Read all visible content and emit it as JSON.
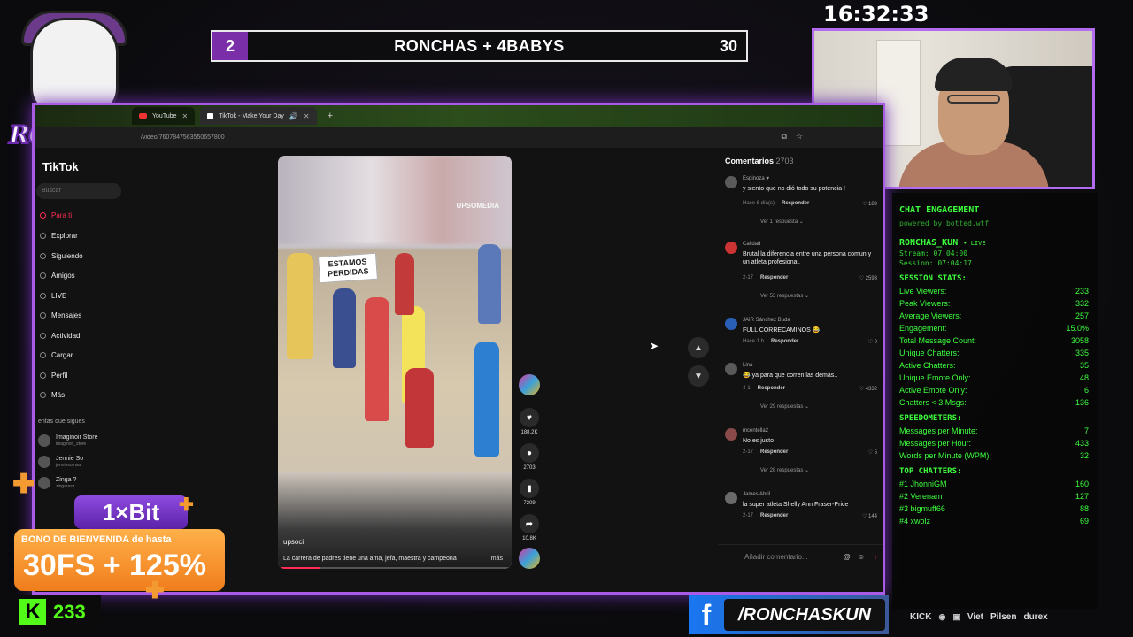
{
  "overlay": {
    "clock": "16:32:33",
    "scorebar": {
      "left_score": "2",
      "title": "RONCHAS + 4BABYS",
      "right_score": "30"
    },
    "logo_text": "RONCHAS"
  },
  "browser": {
    "tabs": [
      {
        "label": "YouTube",
        "icon": "youtube-icon"
      },
      {
        "label": "TikTok - Make Your Day",
        "icon": "tiktok-icon"
      }
    ],
    "url": "/video/7607847563550657800"
  },
  "tiktok": {
    "logo": "TikTok",
    "search_placeholder": "Buscar",
    "nav": [
      "Para ti",
      "Explorar",
      "Siguiendo",
      "Amigos",
      "LIVE",
      "Mensajes",
      "Actividad",
      "Cargar",
      "Perfil",
      "Más"
    ],
    "following_header": "entas que sigues",
    "accounts": [
      {
        "name": "Imaginoir Store",
        "handle": "imaginoir_store"
      },
      {
        "name": "Jennie So",
        "handle": "jenniesomsa"
      },
      {
        "name": "Zinga ?",
        "handle": "zingarasz"
      }
    ],
    "video": {
      "watermark": "UPSOMEDIA",
      "sign_text": "ESTAMOS PERDIDAS",
      "author": "upsoci",
      "caption": "La carrera de padres tiene una ama, jefa, maestra y campeona",
      "more": "más",
      "progress": 0.18
    },
    "actions": [
      {
        "icon": "heart-icon",
        "count": "188.2K"
      },
      {
        "icon": "comment-icon",
        "count": "2703"
      },
      {
        "icon": "bookmark-icon",
        "count": "7209"
      },
      {
        "icon": "share-icon",
        "count": "10.8K"
      }
    ],
    "comments_header": "Comentarios",
    "comments_count": "2703",
    "comments": [
      {
        "user": "Espinoza ♥",
        "text": "y siento que no dió todo su potencia !",
        "time": "Hace 6 día(s)",
        "reply": "Responder",
        "likes": "189",
        "more": "Ver 1 respuesta ⌄"
      },
      {
        "user": "Calidad",
        "text": "Brutal la diferencia entre una persona comun y un atleta profesional.",
        "time": "2-17",
        "reply": "Responder",
        "likes": "2593",
        "more": "Ver 53 respuestas ⌄"
      },
      {
        "user": "JAIR Sánchez Buda",
        "text": "FULL CORRECAMINOS 😂",
        "time": "Hace 1 h",
        "reply": "Responder",
        "likes": "0",
        "more": ""
      },
      {
        "user": "Lina",
        "text": "😂 ya para que corren las demás..",
        "time": "4-1",
        "reply": "Responder",
        "likes": "4332",
        "more": "Ver 29 respuestas ⌄"
      },
      {
        "user": "mcentella2",
        "text": "No es justo",
        "time": "2-17",
        "reply": "Responder",
        "likes": "5",
        "more": "Ver 28 respuestas ⌄"
      },
      {
        "user": "James Abril",
        "text": "la super atleta Shelly Ann Fraser-Price",
        "time": "2-17",
        "reply": "Responder",
        "likes": "144",
        "more": ""
      }
    ],
    "comment_placeholder": "Añadir comentario..."
  },
  "stats": {
    "title": "CHAT ENGAGEMENT",
    "powered": "powered by botted.wtf",
    "username": "RONCHAS_KUN",
    "live_badge": "• LIVE",
    "stream": "Stream: 07:04:00",
    "session": "Session: 07:04:17",
    "sections": [
      {
        "title": "SESSION STATS:",
        "rows": [
          [
            "Live Viewers:",
            "233"
          ],
          [
            "Peak Viewers:",
            "332"
          ],
          [
            "Average Viewers:",
            "257"
          ],
          [
            "Engagement:",
            "15.0%"
          ],
          [
            "Total Message Count:",
            "3058"
          ],
          [
            "Unique Chatters:",
            "335"
          ],
          [
            "Active Chatters:",
            "35"
          ],
          [
            "Unique Emote Only:",
            "48"
          ],
          [
            "Active Emote Only:",
            "6"
          ],
          [
            "Chatters < 3 Msgs:",
            "136"
          ]
        ]
      },
      {
        "title": "SPEEDOMETERS:",
        "rows": [
          [
            "Messages per Minute:",
            "7"
          ],
          [
            "Messages per Hour:",
            "433"
          ],
          [
            "Words per Minute (WPM):",
            "32"
          ]
        ]
      },
      {
        "title": "TOP CHATTERS:",
        "rows": [
          [
            "#1 JhonniGM",
            "160"
          ],
          [
            "#2 Verenam",
            "127"
          ],
          [
            "#3 bigmuff66",
            "88"
          ],
          [
            "#4 xwolz",
            "69"
          ]
        ]
      }
    ]
  },
  "promo": {
    "brand": "1×Bit",
    "line1": "BONO DE BIENVENIDA de hasta",
    "line2": "30FS + 125%"
  },
  "kick": {
    "logo": "K",
    "viewers": "233"
  },
  "facebook": {
    "logo": "f",
    "handle": "/RONCHASKUN"
  },
  "sponsors": [
    "KICK",
    "Viet",
    "Pilsen",
    "durex"
  ],
  "colors": {
    "accent_purple": "#a85ce6",
    "stats_green": "#3dff3d",
    "kick_green": "#53fc18",
    "tiktok_red": "#fe2c55"
  }
}
